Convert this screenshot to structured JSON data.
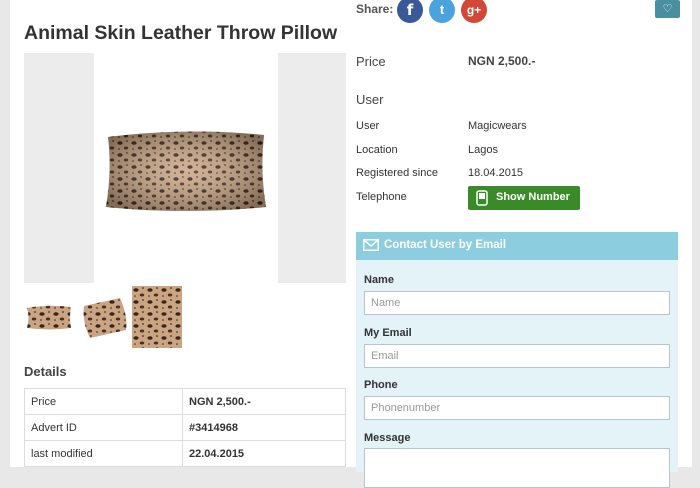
{
  "product": {
    "title": "Animal Skin Leather Throw Pillow"
  },
  "share": {
    "label": "Share:",
    "facebook_glyph": "f",
    "twitter_glyph": "t",
    "googleplus_glyph": "g+"
  },
  "favorite": {
    "icon": "heart-icon",
    "glyph": "♡"
  },
  "price": {
    "label": "Price",
    "value": "NGN 2,500.-"
  },
  "user": {
    "heading": "User",
    "rows": [
      {
        "label": "User",
        "value": "Magicwears"
      },
      {
        "label": "Location",
        "value": "Lagos"
      },
      {
        "label": "Registered since",
        "value": "18.04.2015"
      },
      {
        "label": "Telephone",
        "value": ""
      }
    ],
    "show_number_label": "Show Number"
  },
  "contact": {
    "heading": "Contact User by Email",
    "fields": [
      {
        "label": "Name",
        "placeholder": "Name"
      },
      {
        "label": "My Email",
        "placeholder": "Email"
      },
      {
        "label": "Phone",
        "placeholder": "Phonenumber"
      },
      {
        "label": "Message",
        "placeholder": ""
      }
    ]
  },
  "details": {
    "heading": "Details",
    "rows": [
      {
        "label": "Price",
        "value": "NGN 2,500.-"
      },
      {
        "label": "Advert ID",
        "value": "#3414968"
      },
      {
        "label": "last modified",
        "value": "22.04.2015"
      }
    ]
  },
  "colors": {
    "facebook": "#3b5998",
    "twitter": "#4aa3df",
    "googleplus": "#d14836",
    "show_number_button": "#3a8a2a",
    "contact_header": "#8ccde0",
    "contact_panel": "#e3f3f8"
  }
}
